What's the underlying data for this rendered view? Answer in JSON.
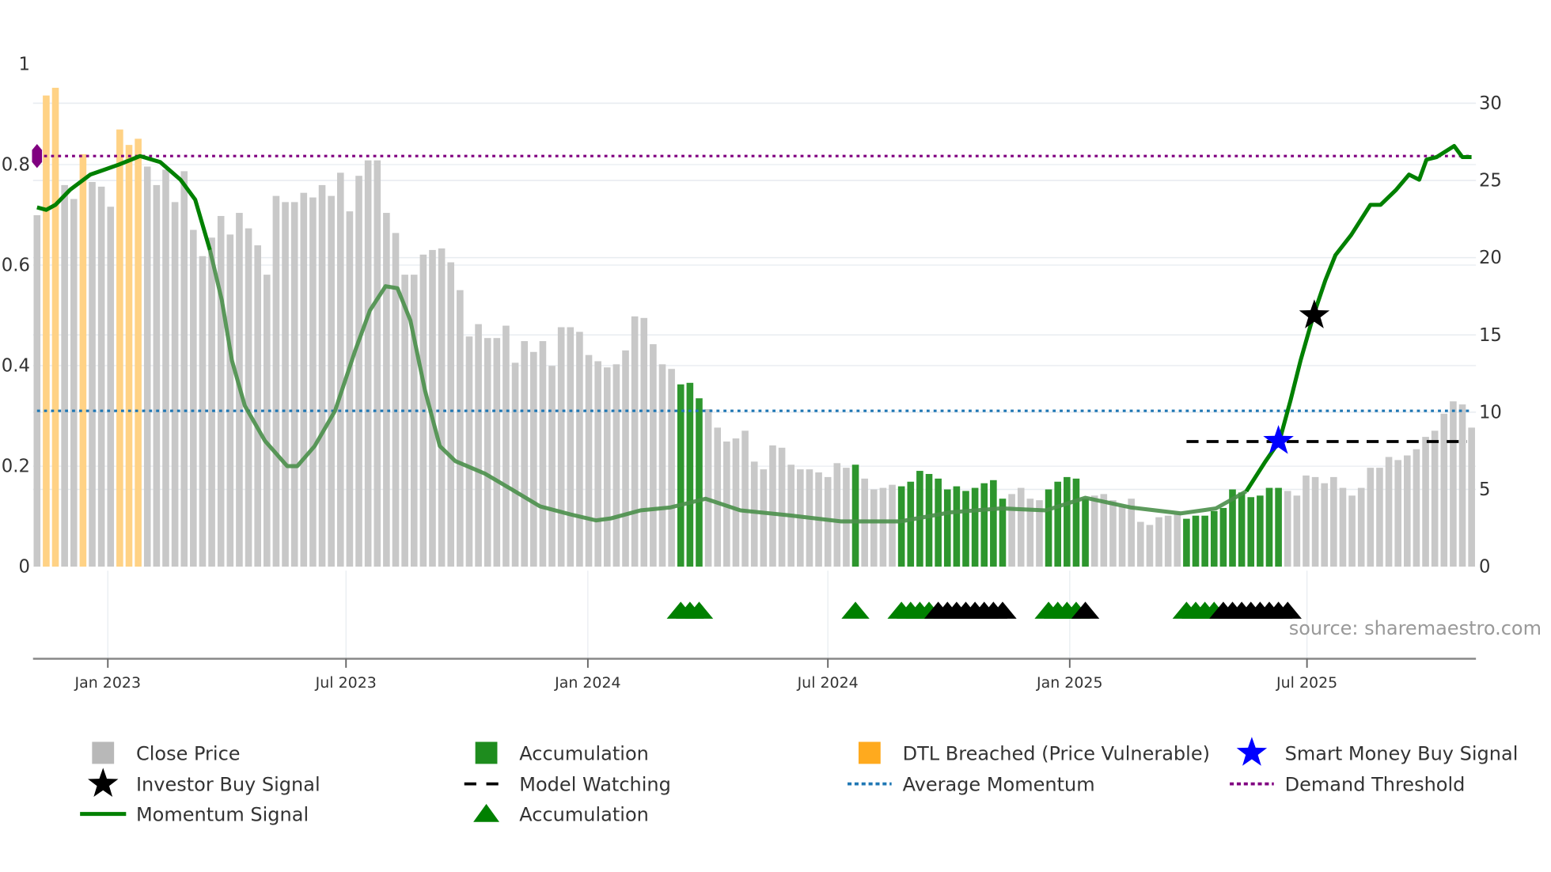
{
  "chart_data": {
    "type": "bar",
    "title": "",
    "x_unit": "week index",
    "x_ticks": [
      {
        "label": "Jan 2023",
        "week": 7.7
      },
      {
        "label": "Jul 2023",
        "week": 33.6
      },
      {
        "label": "Jan 2024",
        "week": 59.9
      },
      {
        "label": "Jul 2024",
        "week": 86.0
      },
      {
        "label": "Jan 2025",
        "week": 112.3
      },
      {
        "label": "Jul 2025",
        "week": 138.1
      }
    ],
    "left_axis": {
      "ylim": [
        0,
        1
      ],
      "ticks": [
        "0",
        "0.2",
        "0.4",
        "0.6",
        "0.8",
        "1"
      ]
    },
    "right_axis": {
      "ylim": [
        0,
        30
      ],
      "ticks": [
        "0",
        "5",
        "10",
        "15",
        "20",
        "25",
        "30"
      ]
    },
    "close_price": [
      22.75,
      30.5,
      31.0,
      24.7,
      23.8,
      26.7,
      24.9,
      24.6,
      23.3,
      28.3,
      27.3,
      27.7,
      25.9,
      24.7,
      25.7,
      23.6,
      25.6,
      21.8,
      20.1,
      21.3,
      22.7,
      21.5,
      22.9,
      21.9,
      20.8,
      18.9,
      24.0,
      23.6,
      23.6,
      24.2,
      23.9,
      24.7,
      24.0,
      25.5,
      23.0,
      25.3,
      26.3,
      26.3,
      22.9,
      21.6,
      18.9,
      18.9,
      20.2,
      20.5,
      20.6,
      19.7,
      17.9,
      14.9,
      15.7,
      14.8,
      14.8,
      15.6,
      13.2,
      14.6,
      13.9,
      14.6,
      13.0,
      15.5,
      15.5,
      15.2,
      13.7,
      13.3,
      12.9,
      13.1,
      14.0,
      16.2,
      16.1,
      14.4,
      13.1,
      12.8,
      11.8,
      11.9,
      10.9,
      10.2,
      9.0,
      8.1,
      8.3,
      8.8,
      6.8,
      6.3,
      7.85,
      7.7,
      6.6,
      6.3,
      6.3,
      6.1,
      5.8,
      6.7,
      6.4,
      6.6,
      5.7,
      5.0,
      5.1,
      5.3,
      5.2,
      5.5,
      6.2,
      6.0,
      5.7,
      5.0,
      5.2,
      4.9,
      5.1,
      5.4,
      5.6,
      4.4,
      4.7,
      5.1,
      4.4,
      4.3,
      5.0,
      5.5,
      5.8,
      5.7,
      4.4,
      4.6,
      4.7,
      4.3,
      3.9,
      4.4,
      2.9,
      2.7,
      3.2,
      3.3,
      3.4,
      3.1,
      3.3,
      3.3,
      3.6,
      3.8,
      5.0,
      4.8,
      4.5,
      4.6,
      5.1,
      5.1,
      4.9,
      4.6,
      5.9,
      5.8,
      5.4,
      5.8,
      5.1,
      4.6,
      5.1,
      6.4,
      6.4,
      7.1,
      6.9,
      7.2,
      7.6,
      8.4,
      8.8,
      9.9,
      10.7,
      10.5,
      9.0
    ],
    "accumulation_weeks": [
      70,
      71,
      72,
      89,
      94,
      95,
      96,
      97,
      98,
      99,
      100,
      101,
      102,
      103,
      104,
      105,
      110,
      111,
      112,
      113,
      114,
      125,
      126,
      127,
      128,
      129,
      130,
      131,
      132,
      133,
      134,
      135
    ],
    "dtl_breached_weeks": [
      1,
      2,
      5,
      9,
      10,
      11
    ],
    "momentum": [
      [
        0,
        0.715
      ],
      [
        1,
        0.71
      ],
      [
        2,
        0.72
      ],
      [
        3.6,
        0.75
      ],
      [
        5.8,
        0.78
      ],
      [
        8.9,
        0.8
      ],
      [
        11.2,
        0.817
      ],
      [
        13.4,
        0.805
      ],
      [
        15.6,
        0.77
      ],
      [
        17.2,
        0.73
      ],
      [
        18.8,
        0.63
      ],
      [
        20.1,
        0.53
      ],
      [
        21.2,
        0.41
      ],
      [
        22.6,
        0.32
      ],
      [
        24.8,
        0.25
      ],
      [
        27.2,
        0.2
      ],
      [
        28.3,
        0.2
      ],
      [
        30.2,
        0.24
      ],
      [
        32.4,
        0.31
      ],
      [
        34.6,
        0.43
      ],
      [
        36.2,
        0.51
      ],
      [
        37.9,
        0.558
      ],
      [
        39.2,
        0.554
      ],
      [
        40.6,
        0.49
      ],
      [
        42.2,
        0.35
      ],
      [
        43.8,
        0.24
      ],
      [
        45.5,
        0.21
      ],
      [
        48.7,
        0.185
      ],
      [
        51.5,
        0.155
      ],
      [
        54.7,
        0.12
      ],
      [
        58,
        0.104
      ],
      [
        60.8,
        0.092
      ],
      [
        62.4,
        0.096
      ],
      [
        65.6,
        0.112
      ],
      [
        68.9,
        0.118
      ],
      [
        72.7,
        0.135
      ],
      [
        76.5,
        0.112
      ],
      [
        81.9,
        0.102
      ],
      [
        87.4,
        0.09
      ],
      [
        93.9,
        0.09
      ],
      [
        99.3,
        0.108
      ],
      [
        104.8,
        0.116
      ],
      [
        109.7,
        0.112
      ],
      [
        114,
        0.137
      ],
      [
        118.9,
        0.118
      ],
      [
        124.4,
        0.106
      ],
      [
        128.2,
        0.116
      ],
      [
        131.5,
        0.15
      ],
      [
        133.6,
        0.21
      ],
      [
        135.1,
        0.25
      ],
      [
        136.3,
        0.33
      ],
      [
        137.4,
        0.41
      ],
      [
        138.8,
        0.5
      ],
      [
        140.1,
        0.57
      ],
      [
        141.2,
        0.62
      ],
      [
        142.9,
        0.66
      ],
      [
        145,
        0.72
      ],
      [
        146.1,
        0.72
      ],
      [
        147.8,
        0.75
      ],
      [
        149.2,
        0.78
      ],
      [
        150.3,
        0.77
      ],
      [
        151.1,
        0.81
      ],
      [
        152.2,
        0.815
      ],
      [
        154.1,
        0.837
      ],
      [
        155,
        0.815
      ],
      [
        156,
        0.815
      ]
    ],
    "momentum_faded_range": [
      18.5,
      131
    ],
    "average_momentum": 0.31,
    "demand_threshold": 0.817,
    "model_watching": {
      "value": 8.1,
      "from_week": 125,
      "to_week": 155.5
    },
    "investor_buy_signal": {
      "week": 138.9,
      "value": 0.5
    },
    "smart_money_buy_signal": {
      "week": 135,
      "value": 0.25
    },
    "demand_marker": {
      "week": 0,
      "value": 0.817
    },
    "accumulation_markers": [
      {
        "week": 70,
        "kind": "green"
      },
      {
        "week": 71,
        "kind": "green"
      },
      {
        "week": 72,
        "kind": "green"
      },
      {
        "week": 89,
        "kind": "green"
      },
      {
        "week": 94,
        "kind": "green"
      },
      {
        "week": 95,
        "kind": "green"
      },
      {
        "week": 96,
        "kind": "green"
      },
      {
        "week": 97,
        "kind": "green"
      },
      {
        "week": 98,
        "kind": "black"
      },
      {
        "week": 99,
        "kind": "black"
      },
      {
        "week": 100,
        "kind": "black"
      },
      {
        "week": 101,
        "kind": "black"
      },
      {
        "week": 102,
        "kind": "black"
      },
      {
        "week": 103,
        "kind": "black"
      },
      {
        "week": 104,
        "kind": "black"
      },
      {
        "week": 105,
        "kind": "black"
      },
      {
        "week": 110,
        "kind": "green"
      },
      {
        "week": 111,
        "kind": "green"
      },
      {
        "week": 112,
        "kind": "green"
      },
      {
        "week": 113,
        "kind": "green"
      },
      {
        "week": 114,
        "kind": "black"
      },
      {
        "week": 125,
        "kind": "green"
      },
      {
        "week": 126,
        "kind": "green"
      },
      {
        "week": 127,
        "kind": "green"
      },
      {
        "week": 128,
        "kind": "green"
      },
      {
        "week": 129,
        "kind": "black"
      },
      {
        "week": 130,
        "kind": "black"
      },
      {
        "week": 131,
        "kind": "black"
      },
      {
        "week": 132,
        "kind": "black"
      },
      {
        "week": 133,
        "kind": "black"
      },
      {
        "week": 134,
        "kind": "black"
      },
      {
        "week": 135,
        "kind": "black"
      },
      {
        "week": 136,
        "kind": "black"
      }
    ],
    "legend": [
      {
        "label": "Close Price",
        "icon": "gray-square"
      },
      {
        "label": "Accumulation",
        "icon": "green-square"
      },
      {
        "label": "DTL Breached (Price Vulnerable)",
        "icon": "orange-square"
      },
      {
        "label": "Smart Money Buy Signal",
        "icon": "blue-star"
      },
      {
        "label": "Investor Buy Signal",
        "icon": "black-star"
      },
      {
        "label": "Model Watching",
        "icon": "black-dash"
      },
      {
        "label": "Average Momentum",
        "icon": "blue-dots"
      },
      {
        "label": "Demand Threshold",
        "icon": "purple-dots"
      },
      {
        "label": "Momentum Signal",
        "icon": "green-line"
      },
      {
        "label": "Accumulation",
        "icon": "green-triangle"
      }
    ],
    "legend_placement": "bottom",
    "source": "source: sharemaestro.com"
  },
  "colors": {
    "close": "#c8c8c8",
    "accum": "#2e962e",
    "dtl": "#ffd285",
    "dtl_legend": "#ffaa1e",
    "momentum": "#008000",
    "momentum_faded": "#4a8f4a",
    "avg": "#1f77b4",
    "demand": "#800080",
    "blue_star": "#0000ff",
    "grid": "#e8ecf0"
  }
}
